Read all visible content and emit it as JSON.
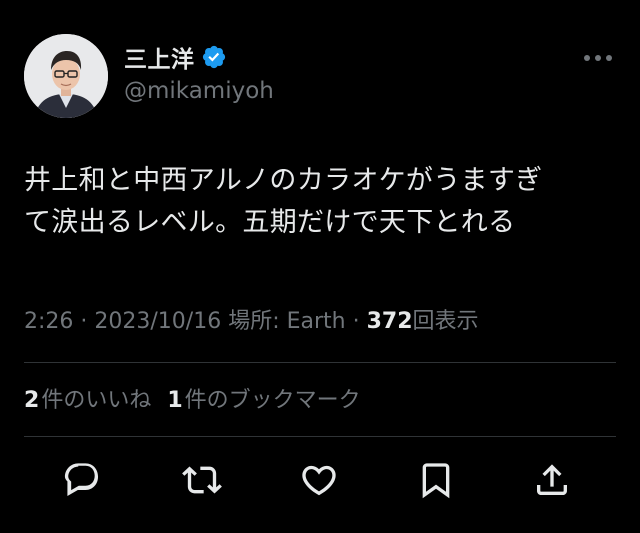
{
  "author": {
    "display_name": "三上洋",
    "handle": "@mikamiyoh",
    "verified_icon": "verified-badge-icon",
    "verified_color": "#1d9bf0"
  },
  "tweet": {
    "text": "井上和と中西アルノのカラオケがうますぎ\nて涙出るレベル。五期だけで天下とれる"
  },
  "meta": {
    "time": "2:26",
    "sep1": " · ",
    "date": "2023/10/16",
    "location": " 場所: Earth",
    "sep2": " · ",
    "views_count": "372",
    "views_label": "回表示"
  },
  "stats": {
    "likes_count": "2",
    "likes_label": "件のいいね",
    "bookmarks_count": "1",
    "bookmarks_label": "件のブックマーク"
  },
  "actions": [
    {
      "icon": "reply-icon"
    },
    {
      "icon": "retweet-icon"
    },
    {
      "icon": "like-heart-icon"
    },
    {
      "icon": "bookmark-icon"
    },
    {
      "icon": "share-icon"
    }
  ],
  "colors": {
    "background": "#000000",
    "text": "#e7e9ea",
    "secondary": "#71767b",
    "divider": "#2f3336"
  }
}
